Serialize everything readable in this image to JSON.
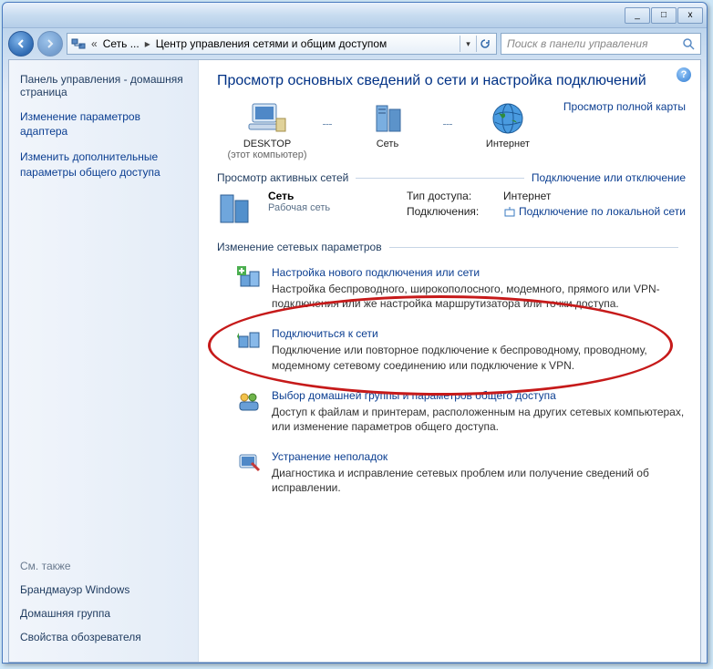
{
  "titlebar": {
    "min": "_",
    "max": "□",
    "close": "x"
  },
  "nav": {
    "crumb1": "Сеть ...",
    "crumb2": "Центр управления сетями и общим доступом",
    "search_placeholder": "Поиск в панели управления"
  },
  "sidebar": {
    "home": "Панель управления - домашняя страница",
    "link1": "Изменение параметров адаптера",
    "link2": "Изменить дополнительные параметры общего доступа",
    "see_also": "См. также",
    "plain1": "Брандмауэр Windows",
    "plain2": "Домашняя группа",
    "plain3": "Свойства обозревателя"
  },
  "main": {
    "title": "Просмотр основных сведений о сети и настройка подключений",
    "node_desktop": "DESKTOP",
    "node_desktop_sub": "(этот компьютер)",
    "node_network": "Сеть",
    "node_internet": "Интернет",
    "full_map": "Просмотр полной карты",
    "active_header": "Просмотр активных сетей",
    "active_action": "Подключение или отключение",
    "net_name": "Сеть",
    "net_type": "Рабочая сеть",
    "det_access_k": "Тип доступа:",
    "det_access_v": "Интернет",
    "det_conn_k": "Подключения:",
    "det_conn_v": "Подключение по локальной сети",
    "change_header": "Изменение сетевых параметров",
    "tasks": [
      {
        "title": "Настройка нового подключения или сети",
        "desc": "Настройка беспроводного, широкополосного, модемного, прямого или VPN-подключения или же настройка маршрутизатора или точки доступа."
      },
      {
        "title": "Подключиться к сети",
        "desc": "Подключение или повторное подключение к беспроводному, проводному, модемному сетевому соединению или подключение к VPN."
      },
      {
        "title": "Выбор домашней группы и параметров общего доступа",
        "desc": "Доступ к файлам и принтерам, расположенным на других сетевых компьютерах, или изменение параметров общего доступа."
      },
      {
        "title": "Устранение неполадок",
        "desc": "Диагностика и исправление сетевых проблем или получение сведений об исправлении."
      }
    ]
  }
}
